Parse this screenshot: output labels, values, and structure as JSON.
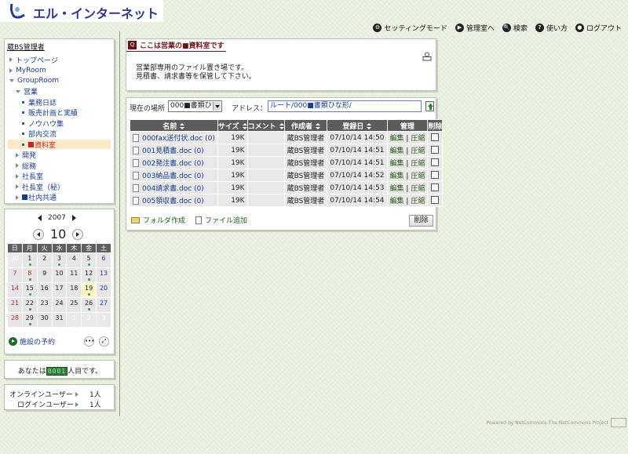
{
  "header": {
    "logo_text": "エル・インターネット",
    "nav": [
      {
        "label": "セッティングモード",
        "icon": "settings-mode-icon",
        "glyph": "⚙"
      },
      {
        "label": "管理室へ",
        "icon": "admin-room-icon",
        "glyph": "▶"
      },
      {
        "label": "検索",
        "icon": "search-icon",
        "glyph": "🔍"
      },
      {
        "label": "使い方",
        "icon": "help-icon",
        "glyph": "?"
      },
      {
        "label": "ログアウト",
        "icon": "logout-icon",
        "glyph": "●"
      }
    ]
  },
  "sidebar": {
    "title": "蔵BS管理者",
    "tree": [
      {
        "label": "トップページ",
        "type": "closed"
      },
      {
        "label": "MyRoom",
        "type": "closed"
      },
      {
        "label": "GroupRoom",
        "type": "open"
      },
      {
        "label": "営業",
        "type": "open"
      },
      {
        "label": "業務日誌",
        "type": "leaf"
      },
      {
        "label": "販売計画と実績",
        "type": "leaf"
      },
      {
        "label": "ノウハウ集",
        "type": "leaf"
      },
      {
        "label": "部内交流",
        "type": "leaf"
      },
      {
        "label": "資料室",
        "type": "leaf-selected"
      },
      {
        "label": "開発",
        "type": "closed"
      },
      {
        "label": "総務",
        "type": "closed"
      },
      {
        "label": "社長室",
        "type": "closed"
      },
      {
        "label": "社長室（秘）",
        "type": "closed"
      },
      {
        "label": "社内共通",
        "type": "closed-square"
      }
    ]
  },
  "calendar": {
    "year": "2007",
    "month": "10",
    "weekdays": [
      "日",
      "月",
      "火",
      "水",
      "木",
      "金",
      "土"
    ],
    "weeks": [
      [
        "30",
        "1",
        "2",
        "3",
        "4",
        "5",
        "6"
      ],
      [
        "7",
        "8",
        "9",
        "10",
        "11",
        "12",
        "13"
      ],
      [
        "14",
        "15",
        "16",
        "17",
        "18",
        "19",
        "20"
      ],
      [
        "21",
        "22",
        "23",
        "24",
        "25",
        "26",
        "27"
      ],
      [
        "28",
        "29",
        "30",
        "31",
        "1",
        "2",
        "3"
      ]
    ],
    "facility_label": "施設の予約"
  },
  "counter": {
    "prefix": "あなたは",
    "digits": "0001",
    "suffix": "人目です。"
  },
  "online": {
    "rows": [
      {
        "label": "オンラインユーザー",
        "count": "1人"
      },
      {
        "label": "ログインユーザー",
        "count": "1人"
      }
    ]
  },
  "info": {
    "title": "ここは営業の■資料室です",
    "body_line1": "営業部専用のファイル置き場です。",
    "body_line2": "見積書、請求書等を保管して下さい。"
  },
  "files": {
    "location_label": "現在の場所",
    "location_value": "000■書類ひ",
    "address_label": "アドレス：",
    "address_value": "ルート/000■書類ひな形/",
    "columns": [
      "名前",
      "サイズ",
      "コメント",
      "作成者",
      "登録日",
      "管理",
      "削除"
    ],
    "rows": [
      {
        "name": "000fax送付状.doc (0)",
        "size": "19K",
        "comment": "",
        "author": "蔵BS管理者",
        "date": "07/10/14 14:50",
        "edit": "編集",
        "zip": "圧縮"
      },
      {
        "name": "001見積書.doc (0)",
        "size": "19K",
        "comment": "",
        "author": "蔵BS管理者",
        "date": "07/10/14 14:51",
        "edit": "編集",
        "zip": "圧縮"
      },
      {
        "name": "002発注書.doc (0)",
        "size": "19K",
        "comment": "",
        "author": "蔵BS管理者",
        "date": "07/10/14 14:51",
        "edit": "編集",
        "zip": "圧縮"
      },
      {
        "name": "003納品書.doc (0)",
        "size": "19K",
        "comment": "",
        "author": "蔵BS管理者",
        "date": "07/10/14 14:52",
        "edit": "編集",
        "zip": "圧縮"
      },
      {
        "name": "004請求書.doc (0)",
        "size": "19K",
        "comment": "",
        "author": "蔵BS管理者",
        "date": "07/10/14 14:53",
        "edit": "編集",
        "zip": "圧縮"
      },
      {
        "name": "005領収書.doc (0)",
        "size": "19K",
        "comment": "",
        "author": "蔵BS管理者",
        "date": "07/10/14 14:54",
        "edit": "編集",
        "zip": "圧縮"
      }
    ],
    "create_folder_label": "フォルダ作成",
    "add_file_label": "ファイル追加",
    "delete_button": "削除"
  },
  "footer": {
    "text": "Powered by NetCommons  The NetCommons Project"
  }
}
